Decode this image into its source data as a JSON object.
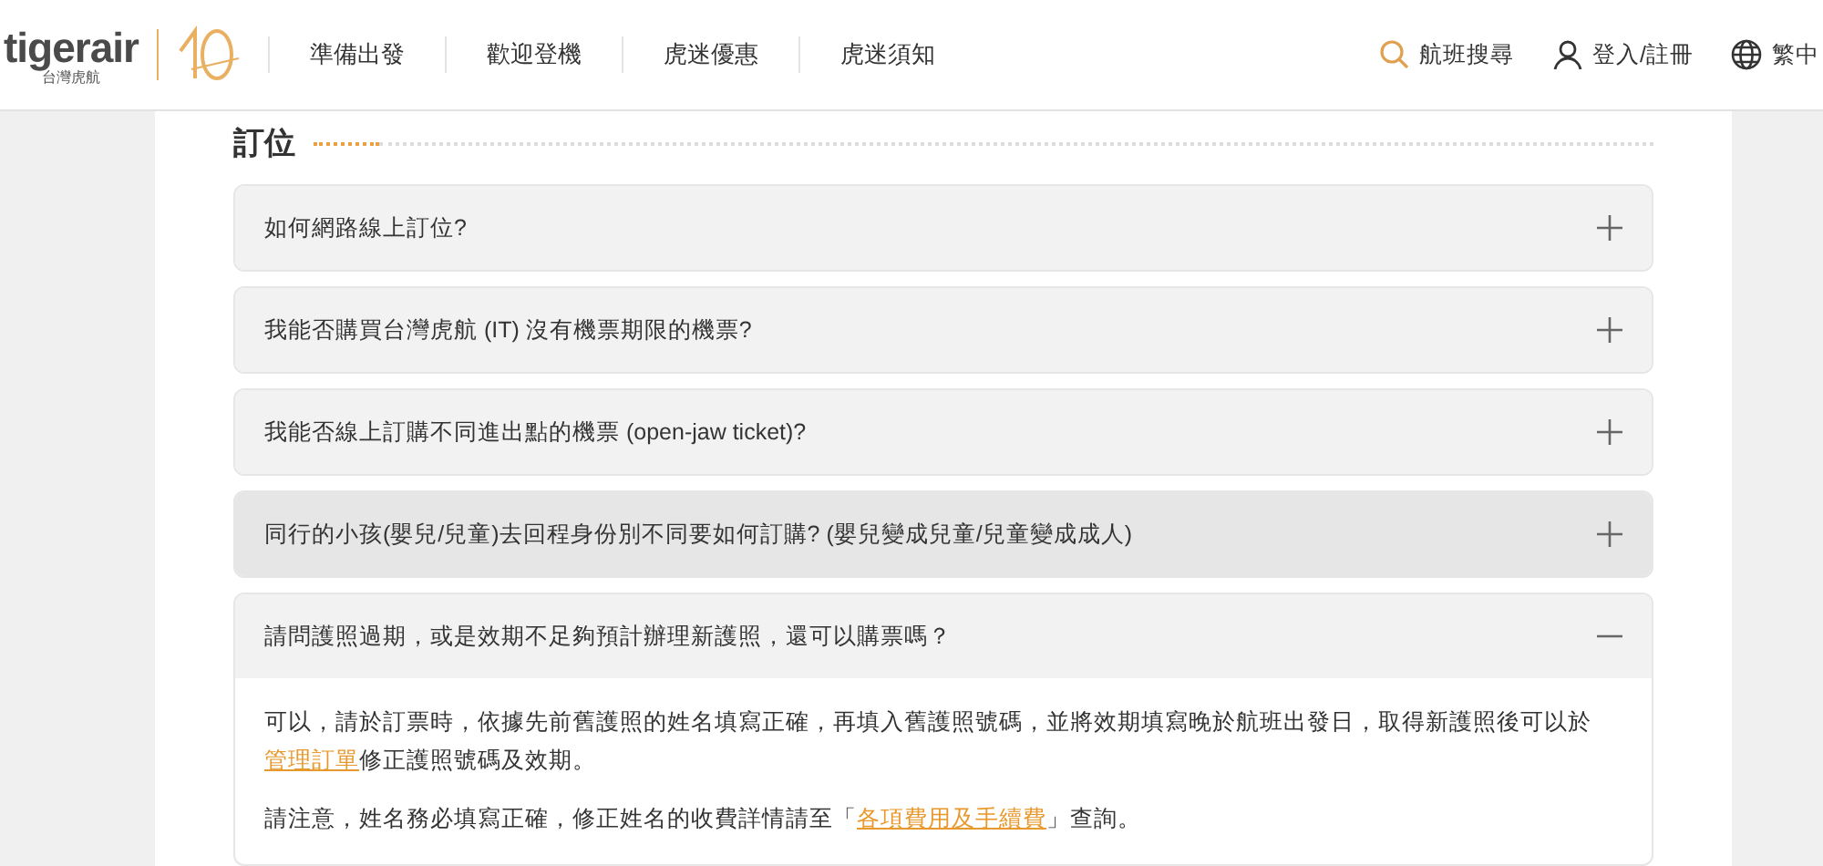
{
  "header": {
    "logo": {
      "name": "tigerair",
      "subtitle": "台灣虎航"
    },
    "nav": [
      "準備出發",
      "歡迎登機",
      "虎迷優惠",
      "虎迷須知"
    ],
    "actions": [
      {
        "kind": "search",
        "label": "航班搜尋"
      },
      {
        "kind": "user",
        "label": "登入/註冊"
      },
      {
        "kind": "language",
        "label": "繁中"
      }
    ]
  },
  "section": {
    "title": "訂位"
  },
  "faq": [
    {
      "question": "如何網路線上訂位?",
      "expanded": false,
      "highlighted": false
    },
    {
      "question": "我能否購買台灣虎航 (IT) 沒有機票期限的機票?",
      "expanded": false,
      "highlighted": false
    },
    {
      "question": "我能否線上訂購不同進出點的機票 (open-jaw ticket)?",
      "expanded": false,
      "highlighted": false
    },
    {
      "question": "同行的小孩(嬰兒/兒童)去回程身份別不同要如何訂購? (嬰兒變成兒童/兒童變成成人)",
      "expanded": false,
      "highlighted": true
    },
    {
      "question": "請問護照過期，或是效期不足夠預計辦理新護照，還可以購票嗎？",
      "expanded": true,
      "highlighted": false,
      "answer": [
        [
          {
            "kind": "text",
            "text": "可以，請於訂票時，依據先前舊護照的姓名填寫正確，再填入舊護照號碼，並將效期填寫晚於航班出發日，取得新護照後可以於"
          },
          {
            "kind": "link",
            "text": "管理訂單"
          },
          {
            "kind": "text",
            "text": "修正護照號碼及效期。"
          }
        ],
        [
          {
            "kind": "text",
            "text": "請注意，姓名務必填寫正確，修正姓名的收費詳情請至「"
          },
          {
            "kind": "link",
            "text": "各項費用及手續費"
          },
          {
            "kind": "text",
            "text": "」查詢。"
          }
        ]
      ]
    }
  ]
}
